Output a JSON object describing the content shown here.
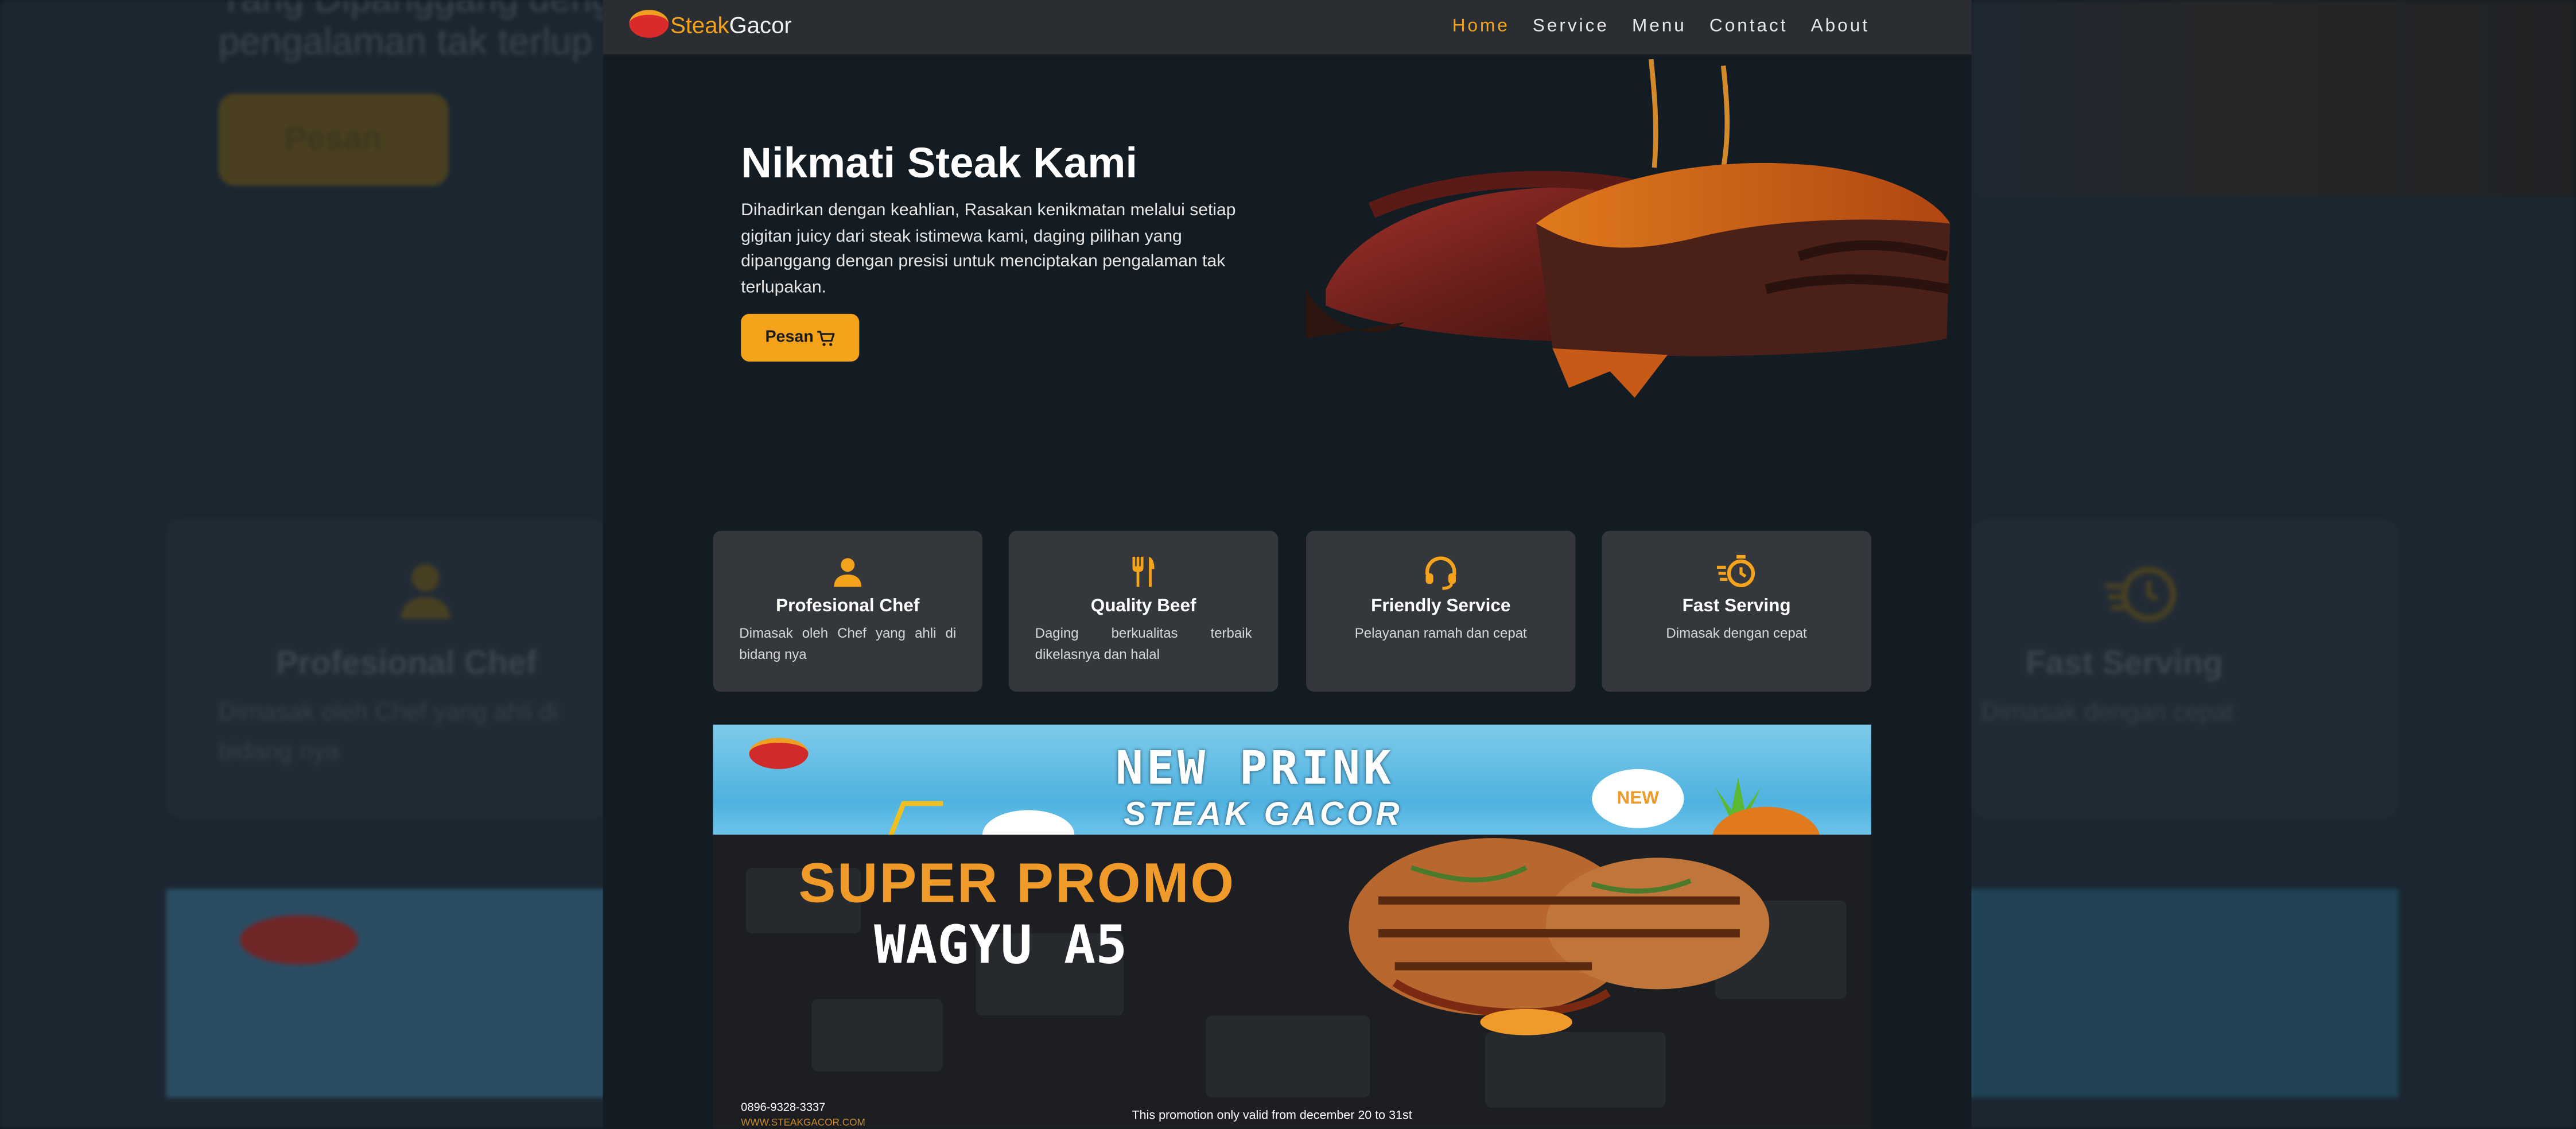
{
  "background": {
    "hero_text_fragment_1": "Yang Dipanggang dengan",
    "hero_text_fragment_2": "pengalaman tak terlup",
    "button_label": "Pesan",
    "card_left_title": "Profesional Chef",
    "card_left_desc": "Dimasak oleh Chef yang ahli di bidang nya",
    "card_right_title": "Fast Serving",
    "card_right_desc": "Dimasak dengan cepat"
  },
  "nav": {
    "brand_part1": "Steak",
    "brand_part2": "Gacor",
    "links": [
      {
        "label": "Home",
        "active": true
      },
      {
        "label": "Service",
        "active": false
      },
      {
        "label": "Menu",
        "active": false
      },
      {
        "label": "Contact",
        "active": false
      },
      {
        "label": "About",
        "active": false
      }
    ]
  },
  "hero": {
    "title": "Nikmati Steak Kami",
    "description": "Dihadirkan dengan keahlian, Rasakan kenikmatan melalui setiap gigitan juicy dari steak istimewa kami, daging pilihan yang dipanggang dengan presisi untuk menciptakan pengalaman tak terlupakan.",
    "button_label": "Pesan",
    "image_alt": "steak"
  },
  "features": [
    {
      "icon": "chef-icon",
      "title": "Profesional Chef",
      "description": "Dimasak oleh Chef yang ahli di bidang nya"
    },
    {
      "icon": "fork-knife-icon",
      "title": "Quality Beef",
      "description": "Daging berkualitas terbaik dikelasnya dan halal"
    },
    {
      "icon": "headset-icon",
      "title": "Friendly Service",
      "description": "Pelayanan ramah dan cepat"
    },
    {
      "icon": "stopwatch-icon",
      "title": "Fast Serving",
      "description": "Dimasak dengan cepat"
    }
  ],
  "banner": {
    "drink_line1": "NEW PRINK",
    "drink_line2": "STEAK GACOR",
    "new_badge": "NEW",
    "promo_line1": "SUPER PROMO",
    "promo_line2": "WAGYU A5",
    "phone": "0896-9328-3337",
    "website": "WWW.STEAKGACOR.COM",
    "note": "This promotion only valid from december 20 to 31st"
  },
  "colors": {
    "accent": "#f5a31a",
    "page_bg": "#141c23",
    "nav_bg": "#2a2d31",
    "card_bg": "#34373b"
  }
}
